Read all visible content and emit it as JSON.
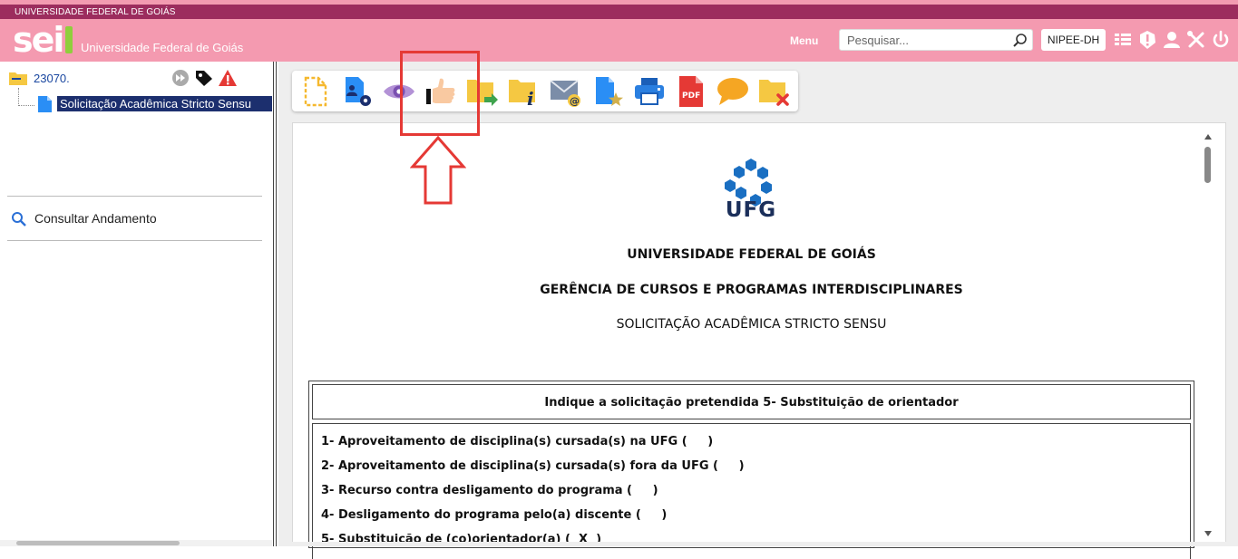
{
  "institution_strip": "UNIVERSIDADE FEDERAL DE GOIÁS",
  "header": {
    "logo_text": "sei",
    "org_name": "Universidade Federal de Goiás",
    "menu_label": "Menu",
    "search_placeholder": "Pesquisar...",
    "unit": "NIPEE-DH",
    "icons": [
      "list-icon",
      "alert-icon",
      "user-icon",
      "tools-icon",
      "power-icon"
    ]
  },
  "tree": {
    "process_number": "23070.",
    "document_label": "Solicitação Acadêmica Stricto Sensu",
    "status_icons": [
      "forward-icon",
      "tag-icon",
      "warning-icon"
    ]
  },
  "sidebar": {
    "consult_label": "Consultar Andamento"
  },
  "toolbar": {
    "buttons": [
      "new-document-icon",
      "document-settings-icon",
      "view-icon",
      "sign-icon",
      "send-process-icon",
      "process-info-icon",
      "send-email-icon",
      "favorite-document-icon",
      "print-icon",
      "pdf-icon",
      "comment-icon",
      "delete-icon"
    ]
  },
  "document": {
    "logo_text": "UFG",
    "title1": "UNIVERSIDADE FEDERAL DE GOIÁS",
    "title2": "GERÊNCIA DE CURSOS E PROGRAMAS INTERDISCIPLINARES",
    "title3": "SOLICITAÇÃO ACADÊMICA STRICTO SENSU",
    "table_header": "Indique a solicitação pretendida 5- Substituição de orientador",
    "options": [
      "1- Aproveitamento de disciplina(s) cursada(s) na UFG (     )",
      "2- Aproveitamento de disciplina(s) cursada(s) fora da UFG (     )",
      "3- Recurso contra desligamento do programa (     )",
      "4- Desligamento do programa pelo(a) discente (     )",
      "5- Substituição de (co)orientador(a) (  X  )"
    ]
  },
  "colors": {
    "header_bg": "#f49ab0",
    "strip_bg": "#9c2d5e",
    "selected_bg": "#1c2f6e",
    "highlight": "#e53935"
  }
}
